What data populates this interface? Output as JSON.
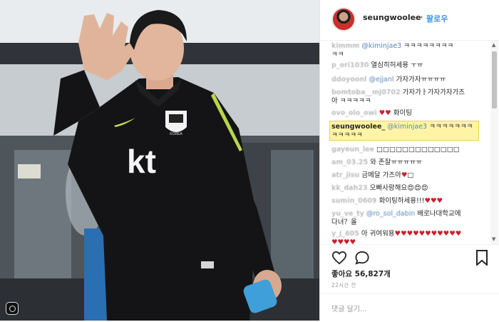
{
  "post": {
    "username": "seungwoolee",
    "separator": "•",
    "follow_label": "팔로우",
    "likes_label": "좋아요 56,827개",
    "time_label": "22시간 전",
    "add_comment_placeholder": "댓글 달기..."
  },
  "photo": {
    "jersey_text": "kt",
    "crest_text": "KOREA"
  },
  "comments": [
    {
      "user": "kimmm",
      "mention": "@kiminjae3",
      "text": " ㅋㅋㅋㅋㅋㅋㅋㅋ",
      "extra": "ㅋㅋ"
    },
    {
      "user": "p_ori1030",
      "text": "열심히허세용 ㅜㅠ"
    },
    {
      "user": "ddoyoonl",
      "mention": "@ejjanl",
      "text": " 가자가자ㅠㅠㅠㅠ"
    },
    {
      "user": "bomtoba__mj0702",
      "text": " 가자가ㅏ가자가자가즈",
      "extra": "아 ㅋㅋㅋㅋㅋ"
    },
    {
      "user": "ovo_olo_owi",
      "text": " 화이팅",
      "hearts": "♥♥"
    },
    {
      "user": "seungwoolee_",
      "mention": "@kiminjae3",
      "text": " ㅋㅋㅋㅋㅋㅋㅋ",
      "extra": "ㅋㅋㅋㅋㅋ",
      "highlight": true
    },
    {
      "user": "gayeun_lee",
      "text": " □□□□□□□□□□□□□"
    },
    {
      "user": "am_03.25",
      "text": " 와 존잘ㅠㅠㅠㅠㅠ"
    },
    {
      "user": "atr_jisu",
      "text": " 금메달 가즈아",
      "hearts": "♥",
      "tail": "□"
    },
    {
      "user": "kk_dah23",
      "text": " 오빠사랑해요",
      "tail": "😍😍😍"
    },
    {
      "user": "sumin_0609",
      "text": " 화이팅하세용!!!",
      "hearts": "♥♥♥"
    },
    {
      "user": "yu_ve_ty",
      "mention": "@ro_sol_dabin",
      "text": " 배로나대학교에",
      "extra": "다녀？올"
    },
    {
      "user": "y_j_605",
      "text": " 아 귀여워용",
      "hearts": "♥♥♥♥♥♥♥♥♥♥♥",
      "extra_hearts": "♥♥♥♥"
    }
  ],
  "icons": {
    "like": "heart-outline-icon",
    "comment": "speech-bubble-icon",
    "save": "bookmark-icon",
    "instagram": "instagram-icon"
  },
  "colors": {
    "highlight": "#fff4a6",
    "follow": "#3897f0",
    "heart": "#cc1f2d"
  }
}
